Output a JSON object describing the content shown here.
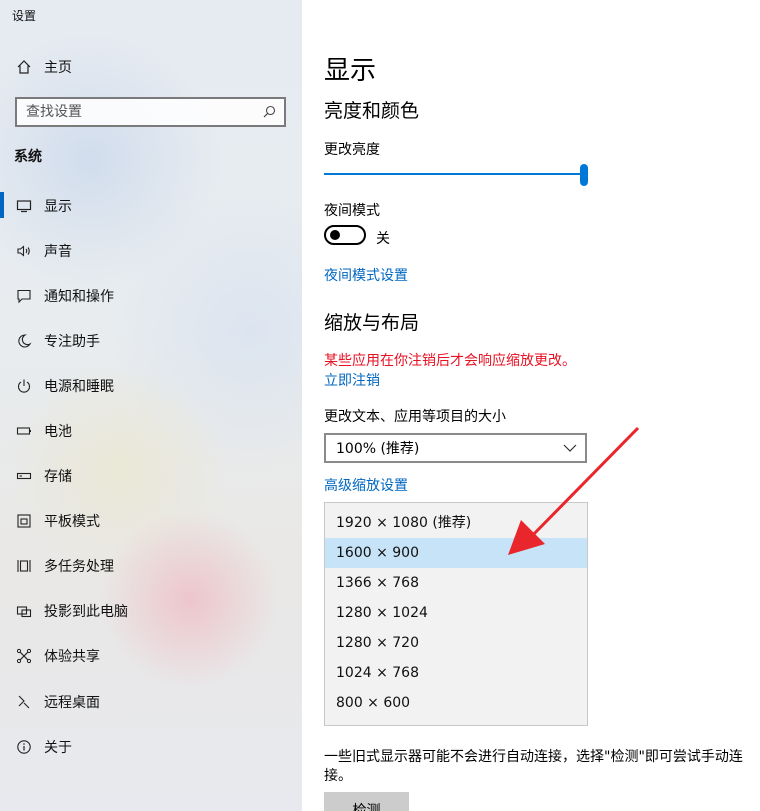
{
  "window": {
    "title": "设置"
  },
  "sidebar": {
    "home_label": "主页",
    "search_placeholder": "查找设置",
    "section_title": "系统",
    "items": [
      {
        "label": "显示",
        "icon": "monitor-icon",
        "active": true
      },
      {
        "label": "声音",
        "icon": "speaker-icon"
      },
      {
        "label": "通知和操作",
        "icon": "notification-icon"
      },
      {
        "label": "专注助手",
        "icon": "moon-icon"
      },
      {
        "label": "电源和睡眠",
        "icon": "power-icon"
      },
      {
        "label": "电池",
        "icon": "battery-icon"
      },
      {
        "label": "存储",
        "icon": "storage-icon"
      },
      {
        "label": "平板模式",
        "icon": "tablet-icon"
      },
      {
        "label": "多任务处理",
        "icon": "multitask-icon"
      },
      {
        "label": "投影到此电脑",
        "icon": "project-icon"
      },
      {
        "label": "体验共享",
        "icon": "share-icon"
      },
      {
        "label": "远程桌面",
        "icon": "remote-desktop-icon"
      },
      {
        "label": "关于",
        "icon": "info-icon"
      }
    ]
  },
  "main": {
    "title": "显示",
    "brightness_heading": "亮度和颜色",
    "brightness_label": "更改亮度",
    "brightness_value": 1.0,
    "night_light_label": "夜间模式",
    "night_light_state": "关",
    "night_light_settings_link": "夜间模式设置",
    "scale_heading": "缩放与布局",
    "warning": "某些应用在你注销后才会响应缩放更改。",
    "sign_out_link": "立即注销",
    "scale_label": "更改文本、应用等项目的大小",
    "scale_value": "100% (推荐)",
    "advanced_scaling_link": "高级缩放设置",
    "resolution_options": [
      "1920 × 1080 (推荐)",
      "1600 × 900",
      "1366 × 768",
      "1280 × 1024",
      "1280 × 720",
      "1024 × 768",
      "800 × 600"
    ],
    "selected_resolution_index": 1,
    "footer_text": "一些旧式显示器可能不会进行自动连接，选择\"检测\"即可尝试手动连接。",
    "detect_button": "检测"
  },
  "colors": {
    "accent": "#0078d7",
    "link": "#0067c0",
    "warning": "#e81123",
    "selected_row": "#c7e3f8",
    "annotation_arrow": "#e8262b"
  }
}
